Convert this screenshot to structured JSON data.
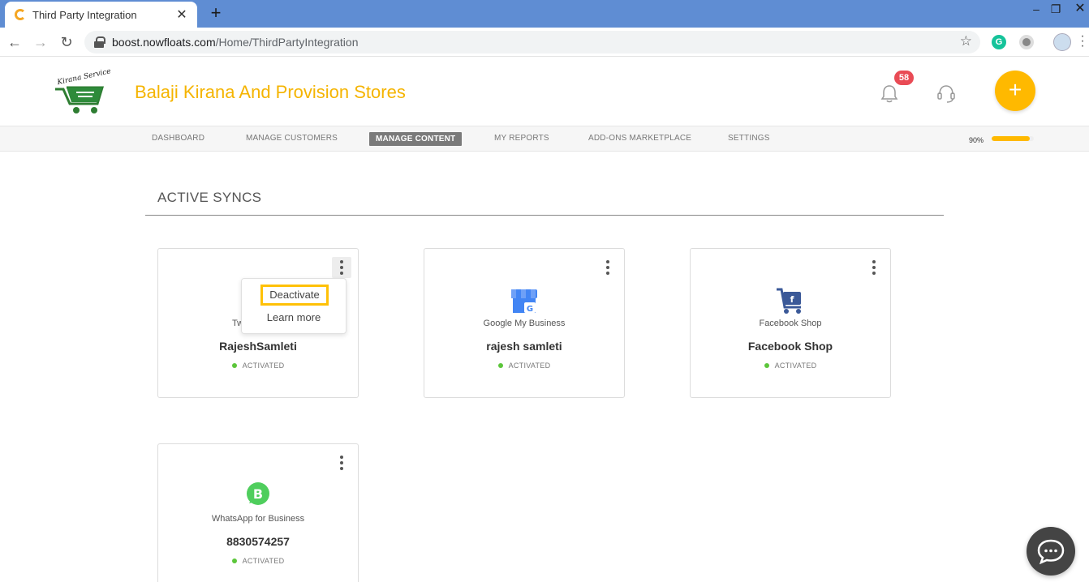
{
  "browser": {
    "tab_title": "Third Party Integration",
    "tab_close": "✕",
    "new_tab": "+",
    "url_host": "boost.nowfloats.com",
    "url_path": "/Home/ThirdPartyIntegration",
    "window_min": "–",
    "window_max": "❐",
    "window_close": "✕",
    "grammarly_letter": "G"
  },
  "header": {
    "store_name": "Balaji Kirana And Provision Stores",
    "logo_text": "Kirana Service",
    "notification_count": "58",
    "fab_symbol": "+"
  },
  "nav": {
    "items": [
      "DASHBOARD",
      "MANAGE CUSTOMERS",
      "MANAGE CONTENT",
      "MY REPORTS",
      "ADD-ONS MARKETPLACE",
      "SETTINGS"
    ],
    "active_index": 2,
    "progress_label": "90%",
    "progress_value": 0.9
  },
  "section": {
    "title": "ACTIVE SYNCS"
  },
  "cards": [
    {
      "platform": "Twitter",
      "platform_visible": "Tw",
      "account": "RajeshSamleti",
      "status": "ACTIVATED",
      "icon": "twitter-icon"
    },
    {
      "platform": "Google My Business",
      "account": "rajesh samleti",
      "status": "ACTIVATED",
      "icon": "google-my-business-icon"
    },
    {
      "platform": "Facebook Shop",
      "account": "Facebook Shop",
      "status": "ACTIVATED",
      "icon": "facebook-shop-icon"
    },
    {
      "platform": "WhatsApp for Business",
      "account": "8830574257",
      "status": "ACTIVATED",
      "icon": "whatsapp-business-icon"
    }
  ],
  "dropdown": {
    "items": [
      "Deactivate",
      "Learn more"
    ]
  },
  "colors": {
    "brand": "#f5b400",
    "fab": "#ffb900",
    "badge": "#e94b55",
    "status_active": "#5cc63b",
    "highlight": "#ffc107",
    "tabstrip": "#5f8dd3"
  }
}
